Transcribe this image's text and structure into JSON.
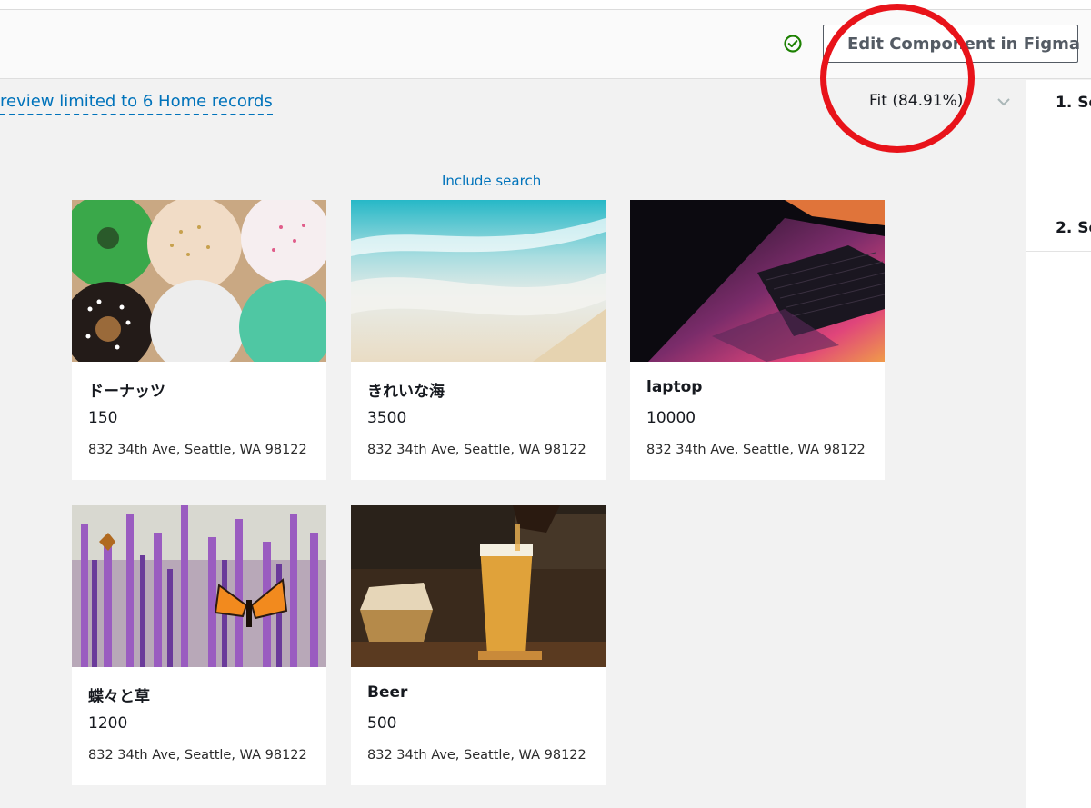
{
  "header": {
    "edit_button_label": "Edit Component in Figma"
  },
  "toolbar": {
    "preview_notice": "review limited to 6 Home records",
    "zoom_label": "Fit (84.91%)"
  },
  "right_panel": {
    "step1": "1. Se",
    "step2": "2. Se"
  },
  "include_search": "Include search",
  "cards": [
    {
      "title": "ドーナッツ",
      "price": "150",
      "address": "832 34th Ave, Seattle, WA 98122",
      "image": "donuts"
    },
    {
      "title": "きれいな海",
      "price": "3500",
      "address": "832 34th Ave, Seattle, WA 98122",
      "image": "beach"
    },
    {
      "title": "laptop",
      "price": "10000",
      "address": "832 34th Ave, Seattle, WA 98122",
      "image": "laptop"
    },
    {
      "title": "蝶々と草",
      "price": "1200",
      "address": "832 34th Ave, Seattle, WA 98122",
      "image": "butterfly-lavender"
    },
    {
      "title": "Beer",
      "price": "500",
      "address": "832 34th Ave, Seattle, WA 98122",
      "image": "beer"
    }
  ],
  "colors": {
    "link": "#0073bb",
    "success": "#1d8102",
    "annotation": "#e8131a"
  }
}
